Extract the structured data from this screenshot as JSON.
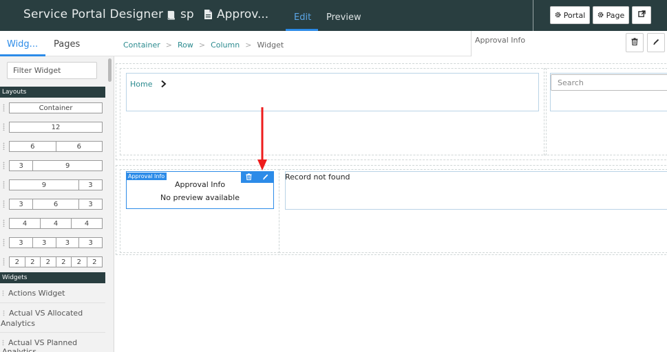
{
  "header": {
    "app_title": "Service Portal Designer",
    "portal_crumb": "sp",
    "page_crumb": "Approv...",
    "tabs": {
      "edit": "Edit",
      "preview": "Preview"
    },
    "buttons": {
      "portal": "Portal",
      "page": "Page"
    },
    "icons": [
      "book-icon",
      "document-icon",
      "gear-icon",
      "external-link-icon"
    ],
    "accent_color": "#2c8be8",
    "bar_color": "#293e40"
  },
  "sidebar": {
    "tabs": {
      "widgets": "Widg...",
      "pages": "Pages"
    },
    "filter_placeholder": "Filter Widget",
    "layouts_heading": "Layouts",
    "layouts": [
      [
        "Container"
      ],
      [
        "12"
      ],
      [
        "6",
        "6"
      ],
      [
        "3",
        "9"
      ],
      [
        "9",
        "3"
      ],
      [
        "3",
        "6",
        "3"
      ],
      [
        "4",
        "4",
        "4"
      ],
      [
        "3",
        "3",
        "3",
        "3"
      ],
      [
        "2",
        "2",
        "2",
        "2",
        "2",
        "2"
      ]
    ],
    "widgets_heading": "Widgets",
    "widgets": [
      "Actions Widget",
      "Actual VS Allocated Analytics",
      "Actual VS Planned Analytics"
    ]
  },
  "breadcrumb": {
    "items": [
      "Container",
      "Row",
      "Column"
    ],
    "current": "Widget"
  },
  "properties": {
    "title": "Approval Info",
    "icons": [
      "trash-icon",
      "pencil-icon"
    ]
  },
  "canvas": {
    "home_link": "Home",
    "search_placeholder": "Search",
    "selected_widget": {
      "tag": "Approval Info",
      "title": "Approval Info",
      "subtitle": "No preview available"
    },
    "record_message": "Record not found",
    "annotation_arrow_color": "#ee1c1c"
  }
}
